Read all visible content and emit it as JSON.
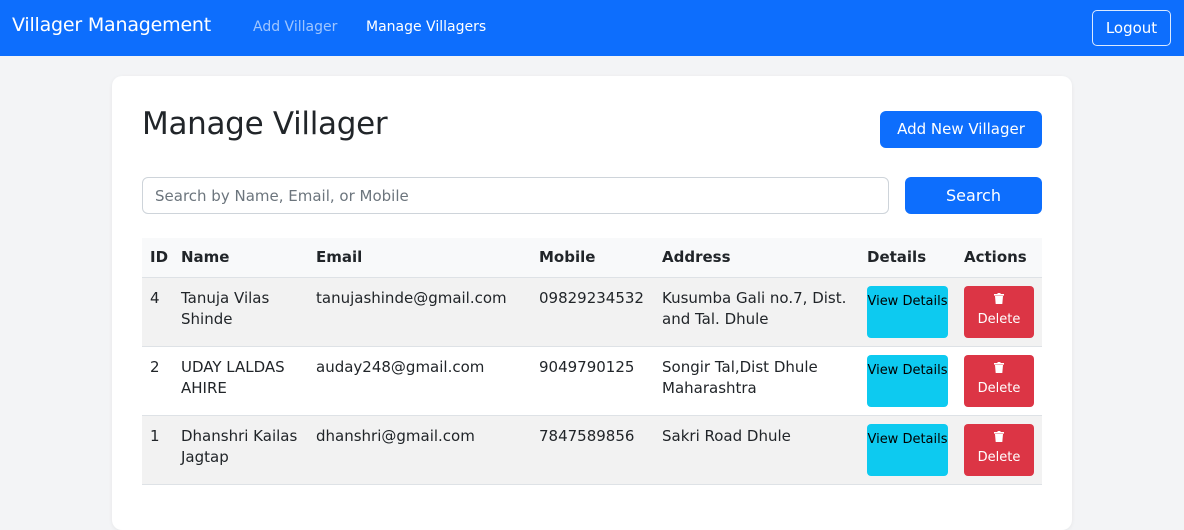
{
  "navbar": {
    "brand": "Villager Management",
    "links": [
      "Add Villager",
      "Manage Villagers"
    ],
    "logout": "Logout"
  },
  "page": {
    "title": "Manage Villager",
    "add_button": "Add New Villager"
  },
  "search": {
    "placeholder": "Search by Name, Email, or Mobile",
    "value": "",
    "button": "Search"
  },
  "table": {
    "headers": [
      "ID",
      "Name",
      "Email",
      "Mobile",
      "Address",
      "Details",
      "Actions"
    ],
    "rows": [
      {
        "id": "4",
        "name": "Tanuja Vilas Shinde",
        "email": "tanujashinde@gmail.com",
        "mobile": "09829234532",
        "address": "Kusumba Gali no.7, Dist. and Tal. Dhule",
        "details": "View Details",
        "action": "Delete"
      },
      {
        "id": "2",
        "name": "UDAY LALDAS AHIRE",
        "email": "auday248@gmail.com",
        "mobile": "9049790125",
        "address": "Songir Tal,Dist Dhule Maharashtra",
        "details": "View Details",
        "action": "Delete"
      },
      {
        "id": "1",
        "name": "Dhanshri Kailas Jagtap",
        "email": "dhanshri@gmail.com",
        "mobile": "7847589856",
        "address": "Sakri Road Dhule",
        "details": "View Details",
        "action": "Delete"
      }
    ]
  },
  "icons": {
    "delete": "trash-icon"
  },
  "colors": {
    "primary": "#0d6efd",
    "info": "#0dcaf0",
    "danger": "#dc3545"
  }
}
